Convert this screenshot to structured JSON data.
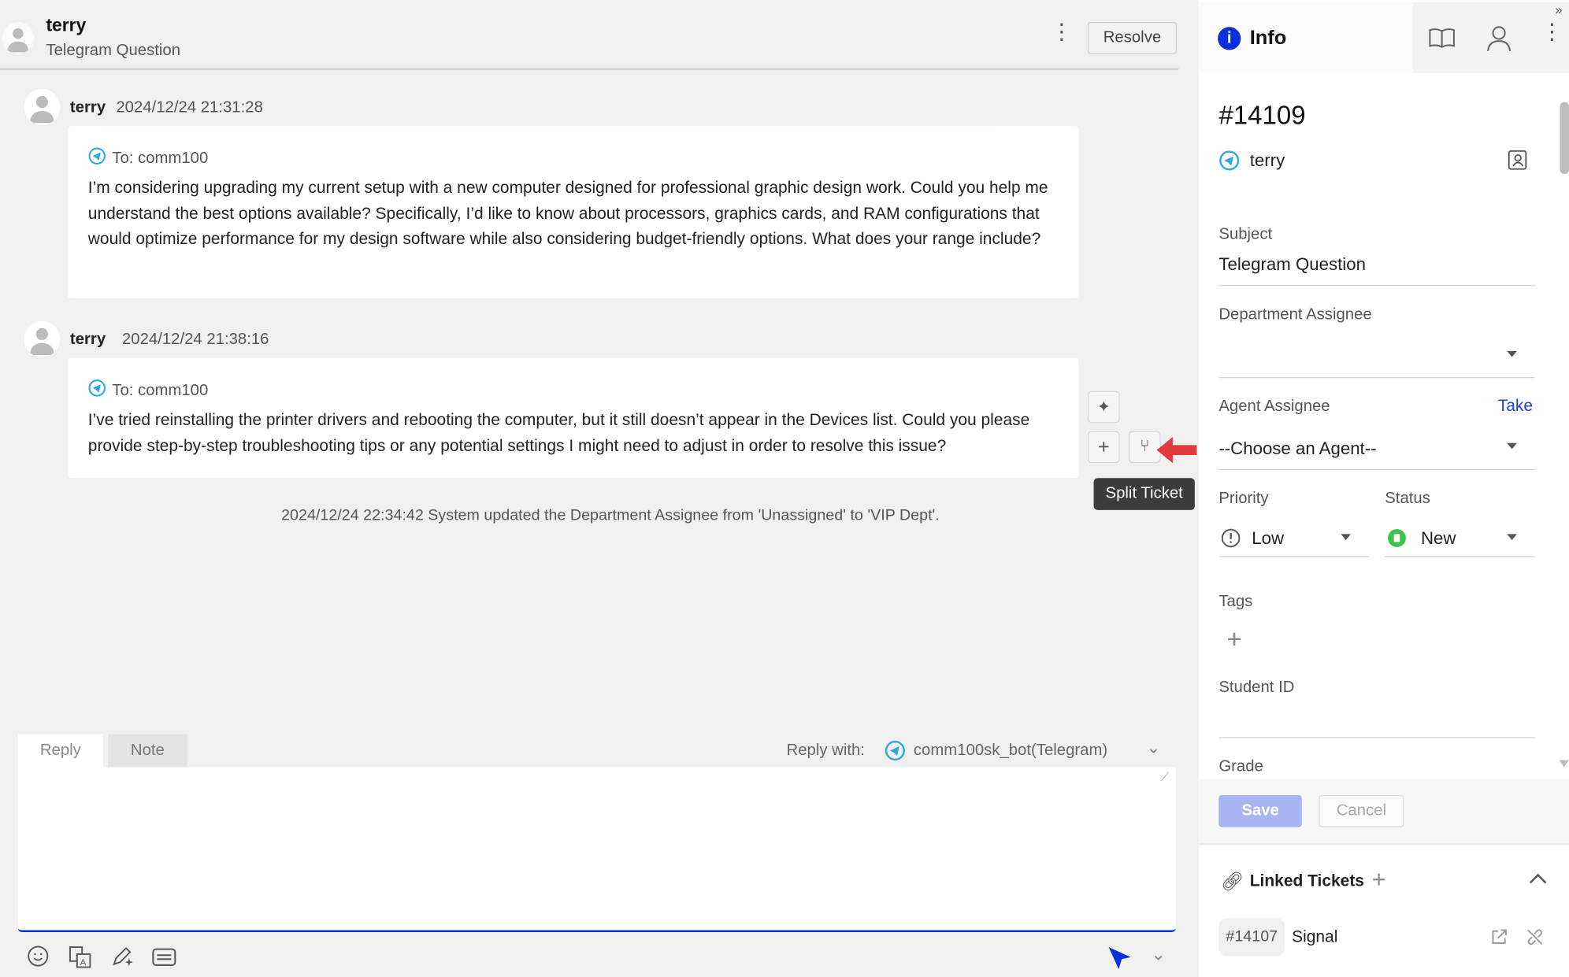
{
  "header": {
    "name": "terry",
    "subject": "Telegram Question",
    "resolve_label": "Resolve"
  },
  "messages": [
    {
      "author": "terry",
      "time": "2024/12/24 21:31:28",
      "to": "To: comm100",
      "body": "I’m considering upgrading my current setup with a new computer designed for professional graphic design work. Could you help me understand the best options available? Specifically, I’d like to know about processors, graphics cards, and RAM configurations that would optimize performance for my design software while also considering budget-friendly options. What does your range include?"
    },
    {
      "author": "terry",
      "time": "2024/12/24 21:38:16",
      "to": "To: comm100",
      "body": "I’ve tried reinstalling the printer drivers and rebooting the computer, but it still doesn’t appear in the Devices list. Could you please provide step-by-step troubleshooting tips or any potential settings I might need to adjust in order to resolve this issue?"
    }
  ],
  "tooltip": "Split Ticket",
  "system_event": "2024/12/24 22:34:42 System updated the Department Assignee from 'Unassigned' to 'VIP Dept'.",
  "reply": {
    "tabs": [
      "Reply",
      "Note"
    ],
    "active_tab": "Reply",
    "reply_with_label": "Reply with:",
    "channel": "comm100sk_bot(Telegram)",
    "text": ""
  },
  "panel": {
    "tab_label": "Info",
    "ticket_id": "#14109",
    "contact": "terry",
    "subject_label": "Subject",
    "subject_value": "Telegram Question",
    "dept_label": "Department Assignee",
    "dept_value": "",
    "agent_label": "Agent Assignee",
    "take_label": "Take",
    "agent_value": "--Choose an Agent--",
    "priority_label": "Priority",
    "priority_value": "Low",
    "status_label": "Status",
    "status_value": "New",
    "tags_label": "Tags",
    "student_label": "Student ID",
    "student_value": "",
    "grade_label": "Grade",
    "save_label": "Save",
    "cancel_label": "Cancel",
    "linked_label": "Linked Tickets",
    "linked": [
      {
        "id": "#14107",
        "title": "Signal"
      }
    ]
  },
  "colors": {
    "accent": "#0a2fdc",
    "telegram": "#2ea6e0",
    "status_new": "#3cc34a",
    "save_disabled": "#a8b5f2",
    "arrow": "#e03a3a"
  }
}
